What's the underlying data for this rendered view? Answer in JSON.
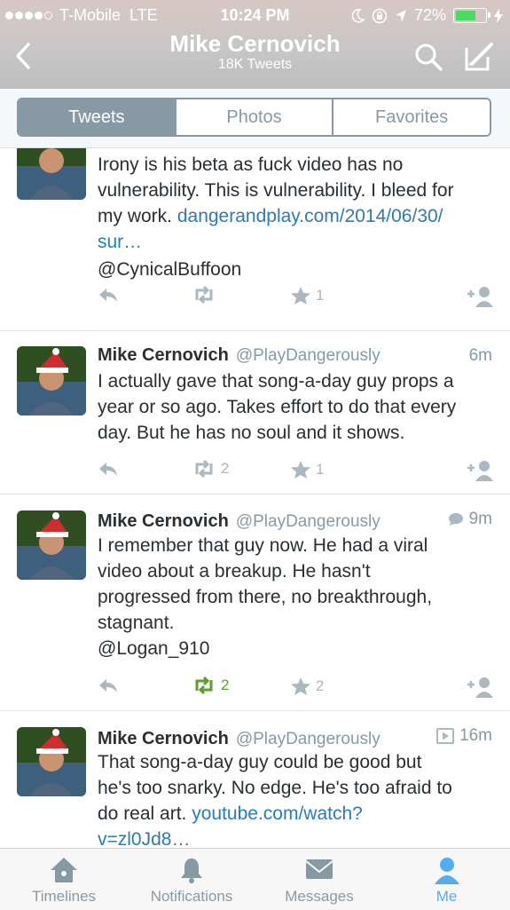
{
  "status_bar": {
    "carrier": "T-Mobile",
    "network": "LTE",
    "time": "10:24 PM",
    "battery": "72%",
    "battery_level": 0.72,
    "signal_bars": 4
  },
  "header": {
    "title": "Mike Cernovich",
    "subtitle": "18K Tweets",
    "back_icon": "chevron-left-icon",
    "search_icon": "search-icon",
    "compose_icon": "compose-icon"
  },
  "tabs": [
    {
      "label": "Tweets",
      "active": true
    },
    {
      "label": "Photos",
      "active": false
    },
    {
      "label": "Favorites",
      "active": false
    }
  ],
  "tweets": [
    {
      "name": "",
      "handle": "",
      "time": "",
      "text_lines": [
        "Irony is his beta as fuck video has no",
        "vulnerability. This is vulnerability. I bleed for",
        "my work. "
      ],
      "link_part1": "dangerandplay.com/2014/06/30/",
      "link_part2": "sur…",
      "mention": "@CynicalBuffoon",
      "retweets": "",
      "favorites": "1"
    },
    {
      "name": "Mike Cernovich",
      "handle": "@PlayDangerously",
      "time": "6m",
      "text_lines": [
        "I actually gave that song-a-day guy props a",
        "year or so ago. Takes effort to do that every",
        "day. But he has no soul and it shows."
      ],
      "retweets": "2",
      "favorites": "1"
    },
    {
      "name": "Mike Cernovich",
      "handle": "@PlayDangerously",
      "time": "9m",
      "text_lines": [
        "I remember that guy now. He had a viral",
        "video about a breakup. He hasn't",
        "progressed from there, no breakthrough,",
        "stagnant."
      ],
      "mention": "@Logan_910",
      "retweets": "2",
      "favorites": "2"
    },
    {
      "name": "Mike Cernovich",
      "handle": "@PlayDangerously",
      "time": "16m",
      "text_lines": [
        "That song-a-day guy could be good but",
        "he's too snarky. No edge. He's too afraid to",
        "do real art. "
      ],
      "link_part1": "youtube.com/watch?",
      "link_part2": "v=zl0Jd8…"
    }
  ],
  "tab_bar": [
    {
      "label": "Timelines",
      "icon": "home-icon",
      "active": false
    },
    {
      "label": "Notifications",
      "icon": "bell-icon",
      "active": false
    },
    {
      "label": "Messages",
      "icon": "envelope-icon",
      "active": false
    },
    {
      "label": "Me",
      "icon": "person-icon",
      "active": true
    }
  ],
  "colors": {
    "accent": "#55acee",
    "link": "#2b7bb9",
    "retweet_active": "#5c9e32",
    "muted": "#8899a6"
  }
}
